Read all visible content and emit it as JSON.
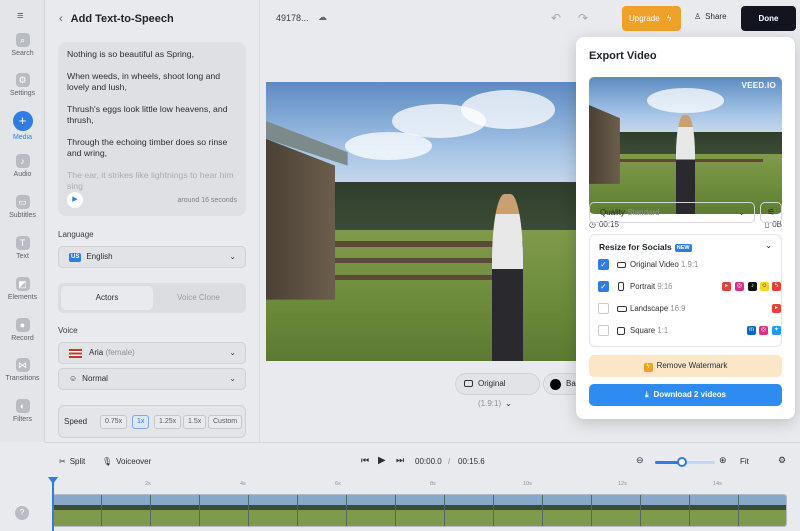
{
  "rail": {
    "items": [
      {
        "label": "Search",
        "icon": "search-icon"
      },
      {
        "label": "Settings",
        "icon": "gear-icon"
      },
      {
        "label": "Media",
        "icon": "plus-icon",
        "active": true
      },
      {
        "label": "Audio",
        "icon": "music-icon"
      },
      {
        "label": "Subtitles",
        "icon": "subtitles-icon"
      },
      {
        "label": "Text",
        "icon": "text-icon"
      },
      {
        "label": "Elements",
        "icon": "elements-icon"
      },
      {
        "label": "Record",
        "icon": "record-icon"
      },
      {
        "label": "Transitions",
        "icon": "transitions-icon"
      },
      {
        "label": "Filters",
        "icon": "filters-icon"
      }
    ],
    "help": "?"
  },
  "panel": {
    "title": "Add Text-to-Speech",
    "poem": [
      "Nothing is so beautiful as Spring,",
      "When weeds, in wheels, shoot long and lovely and lush,",
      "Thrush's eggs look little low heavens, and thrush,",
      "Through the echoing timber does so rinse and wring,",
      "The ear, it strikes like lightnings to hear him sing"
    ],
    "duration_hint": "around 16 seconds",
    "language_label": "Language",
    "language_flag": "US",
    "language_value": "English",
    "tab_actors": "Actors",
    "tab_voice_clone": "Voice Clone",
    "voice_label": "Voice",
    "voice_name": "Aria",
    "voice_gender": "(female)",
    "voice_style": "Normal",
    "speed_label": "Speed",
    "speeds": [
      "0.75x",
      "1x",
      "1.25x",
      "1.5x",
      "Custom"
    ],
    "speed_selected": "1x"
  },
  "topbar": {
    "project_name": "49178...",
    "upgrade_label": "Upgrade",
    "share_label": "Share",
    "done_label": "Done"
  },
  "canvas": {
    "aspect_label": "Original",
    "aspect_ratio": "(1.9:1)",
    "background_label": "Ba"
  },
  "export": {
    "title": "Export Video",
    "watermark": "VEED.IO",
    "duration": "00:15",
    "size": "0B",
    "quality_label": "Quality",
    "quality_value": "Standard",
    "resize_title": "Resize for Socials",
    "new_badge": "NEW",
    "options": [
      {
        "name": "Original Video",
        "ratio": "1.9:1",
        "checked": true
      },
      {
        "name": "Portrait",
        "ratio": "9:16",
        "checked": true
      },
      {
        "name": "Landscape",
        "ratio": "16:9",
        "checked": false
      },
      {
        "name": "Square",
        "ratio": "1:1",
        "checked": false
      }
    ],
    "remove_watermark": "Remove Watermark",
    "download_label": "Download 2 videos"
  },
  "timeline": {
    "split_label": "Split",
    "voiceover_label": "Voiceover",
    "current_time": "00:00.0",
    "separator": "/",
    "total_time": "00:15.6",
    "fit_label": "Fit",
    "ruler": [
      "2s",
      "4s",
      "6s",
      "8s",
      "10s",
      "12s",
      "14s"
    ],
    "zoom_level": 0.45
  },
  "colors": {
    "accent": "#2f7de1",
    "upgrade": "#f0a12a",
    "done": "#12151f"
  }
}
